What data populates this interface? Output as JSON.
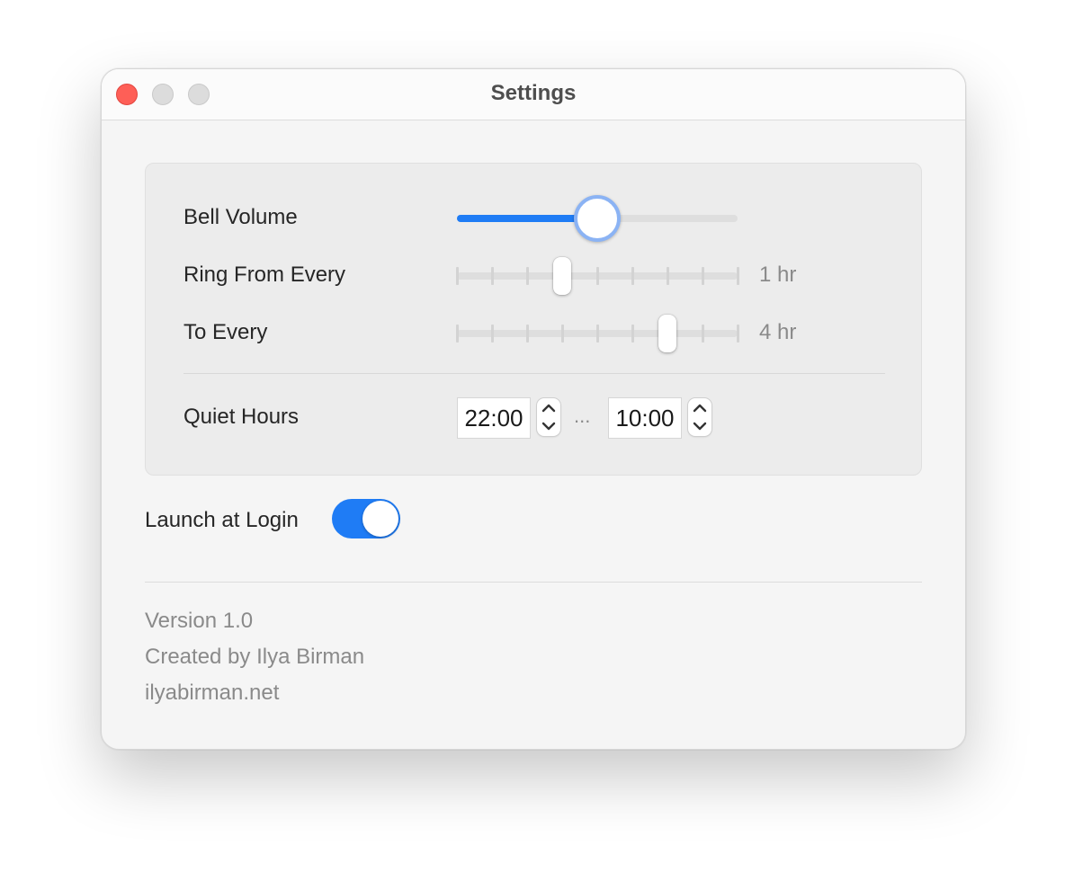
{
  "window": {
    "title": "Settings",
    "controls": [
      "close",
      "minimize",
      "zoom"
    ]
  },
  "settings": {
    "bell_volume": {
      "label": "Bell Volume",
      "value_fraction": 0.5
    },
    "ring_from_every": {
      "label": "Ring From Every",
      "value_text": "1 hr",
      "tick_count": 9,
      "selected_index": 3
    },
    "to_every": {
      "label": "To Every",
      "value_text": "4 hr",
      "tick_count": 9,
      "selected_index": 6
    },
    "quiet_hours": {
      "label": "Quiet Hours",
      "start": "22:00",
      "separator": "...",
      "end": "10:00"
    }
  },
  "launch_at_login": {
    "label": "Launch at Login",
    "enabled": true
  },
  "footer": {
    "version": "Version 1.0",
    "created_by": "Created by Ilya Birman",
    "website": "ilyabirman.net"
  },
  "colors": {
    "accent": "#1f7cf5",
    "close_button": "#fe5f57",
    "inactive_button": "#dcdcdc",
    "focus_ring": "#8bb3f4"
  },
  "icons": {
    "stepper_up": "chevron-up-icon",
    "stepper_down": "chevron-down-icon"
  }
}
